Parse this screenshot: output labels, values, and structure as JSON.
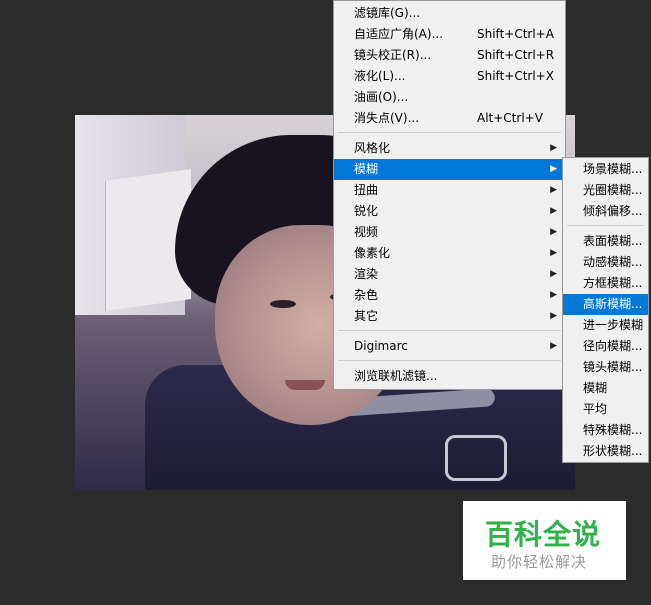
{
  "filter_menu": {
    "items": [
      {
        "label": "滤镜库(G)...",
        "shortcut": ""
      },
      {
        "label": "自适应广角(A)...",
        "shortcut": "Shift+Ctrl+A"
      },
      {
        "label": "镜头校正(R)...",
        "shortcut": "Shift+Ctrl+R"
      },
      {
        "label": "液化(L)...",
        "shortcut": "Shift+Ctrl+X"
      },
      {
        "label": "油画(O)...",
        "shortcut": ""
      },
      {
        "label": "消失点(V)...",
        "shortcut": "Alt+Ctrl+V"
      },
      {
        "label": "风格化"
      },
      {
        "label": "模糊"
      },
      {
        "label": "扭曲"
      },
      {
        "label": "锐化"
      },
      {
        "label": "视频"
      },
      {
        "label": "像素化"
      },
      {
        "label": "渲染"
      },
      {
        "label": "杂色"
      },
      {
        "label": "其它"
      },
      {
        "label": "Digimarc"
      },
      {
        "label": "浏览联机滤镜..."
      }
    ],
    "submenu_arrow": "▶",
    "active_item": "模糊"
  },
  "blur_submenu": {
    "items": [
      {
        "label": "场景模糊..."
      },
      {
        "label": "光圈模糊..."
      },
      {
        "label": "倾斜偏移..."
      },
      {
        "label": "表面模糊..."
      },
      {
        "label": "动感模糊..."
      },
      {
        "label": "方框模糊..."
      },
      {
        "label": "高斯模糊..."
      },
      {
        "label": "进一步模糊"
      },
      {
        "label": "径向模糊..."
      },
      {
        "label": "镜头模糊..."
      },
      {
        "label": "模糊"
      },
      {
        "label": "平均"
      },
      {
        "label": "特殊模糊..."
      },
      {
        "label": "形状模糊..."
      }
    ],
    "active_item": "高斯模糊..."
  },
  "watermark": {
    "title": "百科全说",
    "subtitle": "助你轻松解决",
    "title_color": "#2fb24a"
  },
  "colors": {
    "highlight": "#0078d7",
    "menu_bg": "#f0f0f0",
    "app_bg": "#2b2b2b"
  }
}
